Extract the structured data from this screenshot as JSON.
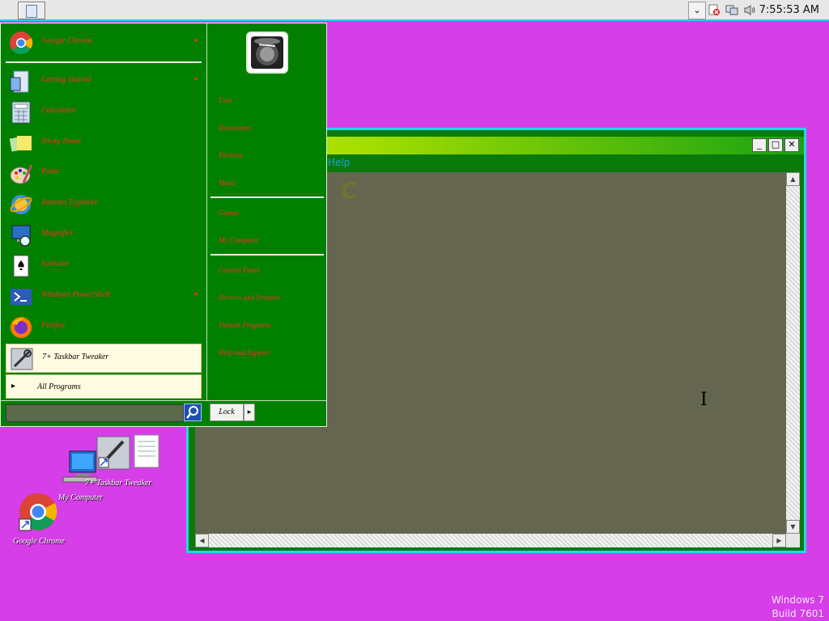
{
  "taskbar": {
    "clock": "7:55:53 AM"
  },
  "window": {
    "menu_help": "Help",
    "ghost_text": "C"
  },
  "startmenu": {
    "programs": [
      {
        "label": "Google Chrome",
        "arrow": "▸",
        "icon": "chrome-icon"
      },
      {
        "label": "Getting Started",
        "arrow": "▸",
        "icon": "getting-started-icon"
      },
      {
        "label": "Calculator",
        "arrow": "",
        "icon": "calculator-icon"
      },
      {
        "label": "Sticky Notes",
        "arrow": "",
        "icon": "sticky-notes-icon"
      },
      {
        "label": "Paint",
        "arrow": "",
        "icon": "paint-icon"
      },
      {
        "label": "Internet Explorer",
        "arrow": "",
        "icon": "ie-icon"
      },
      {
        "label": "Magnifier",
        "arrow": "",
        "icon": "magnifier-icon"
      },
      {
        "label": "Solitaire",
        "arrow": "",
        "icon": "solitaire-icon"
      },
      {
        "label": "Windows PowerShell",
        "arrow": "▸",
        "icon": "powershell-icon"
      },
      {
        "label": "Firefox",
        "arrow": "",
        "icon": "firefox-icon"
      },
      {
        "label": "7+ Taskbar Tweaker",
        "arrow": "",
        "icon": "tweaker-icon"
      }
    ],
    "all_programs": "All Programs",
    "right_links": [
      {
        "label": "User"
      },
      {
        "label": "Documents"
      },
      {
        "label": "Pictures"
      },
      {
        "label": "Music"
      },
      {
        "label": "Games"
      },
      {
        "label": "My Computer"
      },
      {
        "label": "Control Panel"
      },
      {
        "label": "Devices and Printers"
      },
      {
        "label": "Default Programs"
      },
      {
        "label": "Help and Support"
      }
    ],
    "lock_label": "Lock",
    "lock_arrow": "▸",
    "all_programs_arrow": "▸"
  },
  "desktop": {
    "icons": [
      {
        "label": "7+ Taskbar Tweaker"
      },
      {
        "label": "My Computer"
      },
      {
        "label": "Google Chrome"
      }
    ],
    "watermark_line1": "Windows 7",
    "watermark_line2": "Build 7601"
  },
  "colors": {
    "desktop": "#d63ee8",
    "menu_bg": "#018000",
    "menu_text": "#ff2a2a",
    "window_border": "#26d5ea"
  }
}
